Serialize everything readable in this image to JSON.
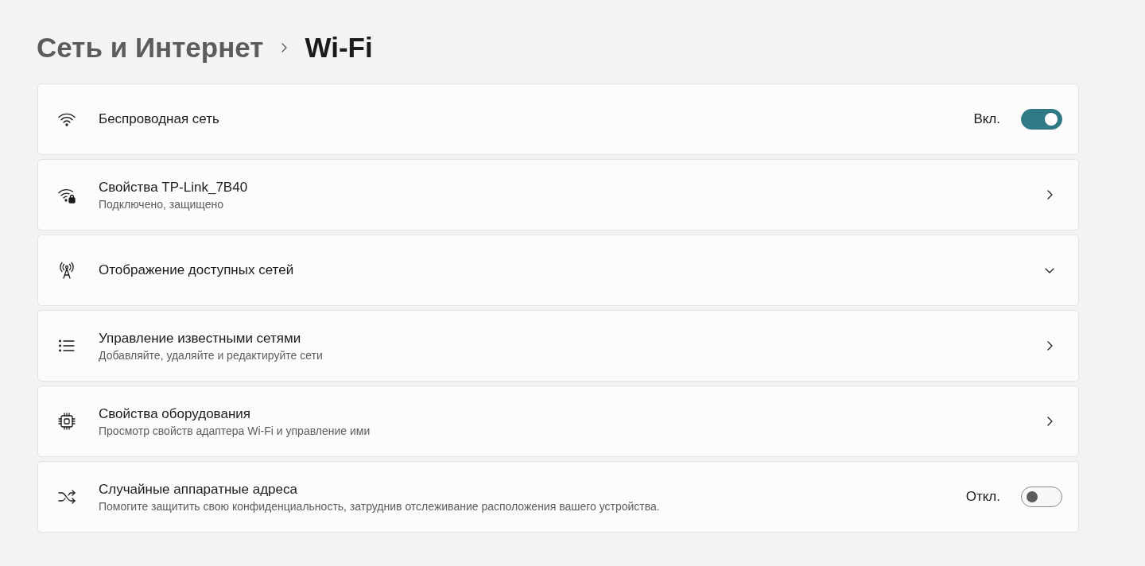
{
  "breadcrumb": [
    {
      "label": "Сеть и Интернет",
      "selected": false
    },
    {
      "label": "Wi-Fi",
      "selected": true
    }
  ],
  "rows": [
    {
      "kind": "toggle",
      "title": "Беспроводная сеть",
      "state_label": "Вкл.",
      "on": true
    },
    {
      "kind": "link",
      "title": "Свойства TP-Link_7B40",
      "subtitle": "Подключено, защищено"
    },
    {
      "kind": "expand",
      "title": "Отображение доступных сетей",
      "expanded": false
    },
    {
      "kind": "link",
      "title": "Управление известными сетями",
      "subtitle": "Добавляйте, удаляйте и редактируйте сети"
    },
    {
      "kind": "link",
      "title": "Свойства оборудования",
      "subtitle": "Просмотр свойств адаптера Wi-Fi и управление ими"
    },
    {
      "kind": "toggle",
      "title": "Случайные аппаратные адреса",
      "subtitle": "Помогите защитить свою конфиденциальность, затруднив отслеживание расположения вашего устройства.",
      "state_label": "Откл.",
      "on": false
    }
  ]
}
